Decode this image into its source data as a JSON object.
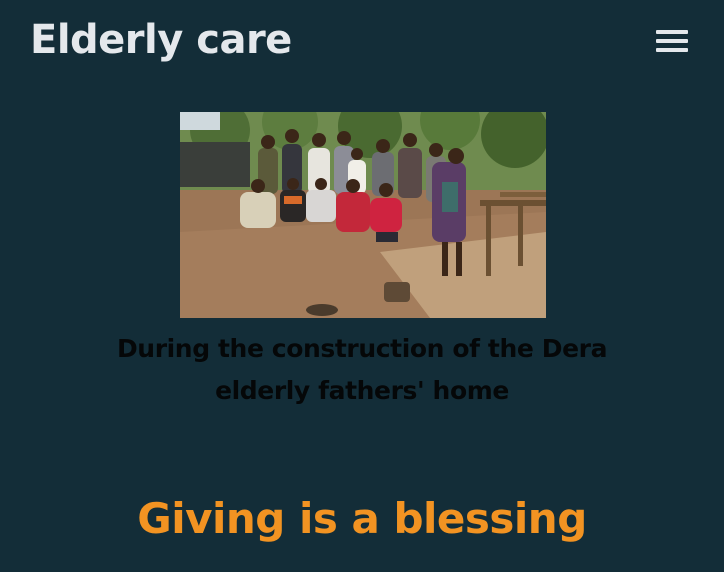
{
  "header": {
    "title": "Elderly care",
    "menu_icon": "hamburger-menu-icon"
  },
  "gallery": {
    "caption": "During the construction of the Dera elderly fathers' home"
  },
  "section": {
    "heading": "Giving is a blessing"
  },
  "colors": {
    "background": "#132d38",
    "title_text": "#e4e8ec",
    "caption_text": "#050708",
    "accent": "#f29322"
  }
}
